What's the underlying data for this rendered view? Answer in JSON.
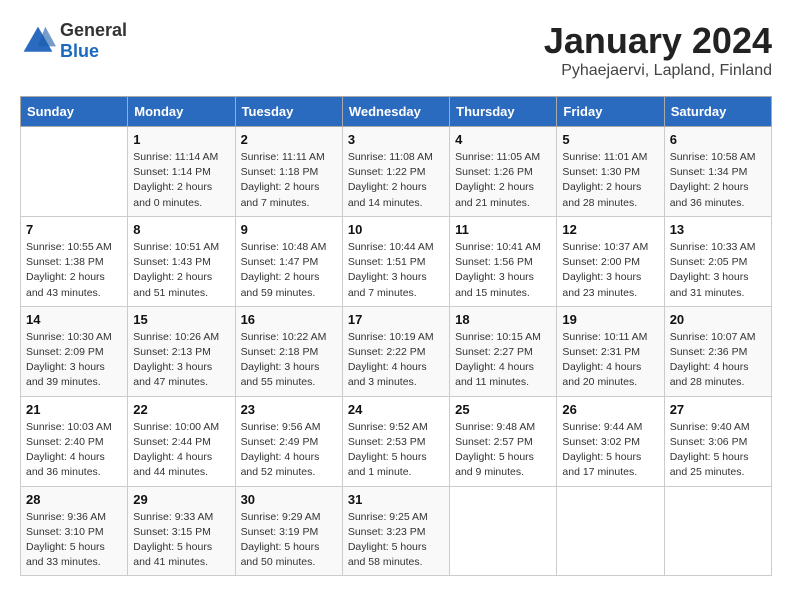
{
  "header": {
    "logo_general": "General",
    "logo_blue": "Blue",
    "title": "January 2024",
    "subtitle": "Pyhaejaervi, Lapland, Finland"
  },
  "days_of_week": [
    "Sunday",
    "Monday",
    "Tuesday",
    "Wednesday",
    "Thursday",
    "Friday",
    "Saturday"
  ],
  "weeks": [
    [
      {
        "day": "",
        "sunrise": "",
        "sunset": "",
        "daylight": ""
      },
      {
        "day": "1",
        "sunrise": "Sunrise: 11:14 AM",
        "sunset": "Sunset: 1:14 PM",
        "daylight": "Daylight: 2 hours and 0 minutes."
      },
      {
        "day": "2",
        "sunrise": "Sunrise: 11:11 AM",
        "sunset": "Sunset: 1:18 PM",
        "daylight": "Daylight: 2 hours and 7 minutes."
      },
      {
        "day": "3",
        "sunrise": "Sunrise: 11:08 AM",
        "sunset": "Sunset: 1:22 PM",
        "daylight": "Daylight: 2 hours and 14 minutes."
      },
      {
        "day": "4",
        "sunrise": "Sunrise: 11:05 AM",
        "sunset": "Sunset: 1:26 PM",
        "daylight": "Daylight: 2 hours and 21 minutes."
      },
      {
        "day": "5",
        "sunrise": "Sunrise: 11:01 AM",
        "sunset": "Sunset: 1:30 PM",
        "daylight": "Daylight: 2 hours and 28 minutes."
      },
      {
        "day": "6",
        "sunrise": "Sunrise: 10:58 AM",
        "sunset": "Sunset: 1:34 PM",
        "daylight": "Daylight: 2 hours and 36 minutes."
      }
    ],
    [
      {
        "day": "7",
        "sunrise": "Sunrise: 10:55 AM",
        "sunset": "Sunset: 1:38 PM",
        "daylight": "Daylight: 2 hours and 43 minutes."
      },
      {
        "day": "8",
        "sunrise": "Sunrise: 10:51 AM",
        "sunset": "Sunset: 1:43 PM",
        "daylight": "Daylight: 2 hours and 51 minutes."
      },
      {
        "day": "9",
        "sunrise": "Sunrise: 10:48 AM",
        "sunset": "Sunset: 1:47 PM",
        "daylight": "Daylight: 2 hours and 59 minutes."
      },
      {
        "day": "10",
        "sunrise": "Sunrise: 10:44 AM",
        "sunset": "Sunset: 1:51 PM",
        "daylight": "Daylight: 3 hours and 7 minutes."
      },
      {
        "day": "11",
        "sunrise": "Sunrise: 10:41 AM",
        "sunset": "Sunset: 1:56 PM",
        "daylight": "Daylight: 3 hours and 15 minutes."
      },
      {
        "day": "12",
        "sunrise": "Sunrise: 10:37 AM",
        "sunset": "Sunset: 2:00 PM",
        "daylight": "Daylight: 3 hours and 23 minutes."
      },
      {
        "day": "13",
        "sunrise": "Sunrise: 10:33 AM",
        "sunset": "Sunset: 2:05 PM",
        "daylight": "Daylight: 3 hours and 31 minutes."
      }
    ],
    [
      {
        "day": "14",
        "sunrise": "Sunrise: 10:30 AM",
        "sunset": "Sunset: 2:09 PM",
        "daylight": "Daylight: 3 hours and 39 minutes."
      },
      {
        "day": "15",
        "sunrise": "Sunrise: 10:26 AM",
        "sunset": "Sunset: 2:13 PM",
        "daylight": "Daylight: 3 hours and 47 minutes."
      },
      {
        "day": "16",
        "sunrise": "Sunrise: 10:22 AM",
        "sunset": "Sunset: 2:18 PM",
        "daylight": "Daylight: 3 hours and 55 minutes."
      },
      {
        "day": "17",
        "sunrise": "Sunrise: 10:19 AM",
        "sunset": "Sunset: 2:22 PM",
        "daylight": "Daylight: 4 hours and 3 minutes."
      },
      {
        "day": "18",
        "sunrise": "Sunrise: 10:15 AM",
        "sunset": "Sunset: 2:27 PM",
        "daylight": "Daylight: 4 hours and 11 minutes."
      },
      {
        "day": "19",
        "sunrise": "Sunrise: 10:11 AM",
        "sunset": "Sunset: 2:31 PM",
        "daylight": "Daylight: 4 hours and 20 minutes."
      },
      {
        "day": "20",
        "sunrise": "Sunrise: 10:07 AM",
        "sunset": "Sunset: 2:36 PM",
        "daylight": "Daylight: 4 hours and 28 minutes."
      }
    ],
    [
      {
        "day": "21",
        "sunrise": "Sunrise: 10:03 AM",
        "sunset": "Sunset: 2:40 PM",
        "daylight": "Daylight: 4 hours and 36 minutes."
      },
      {
        "day": "22",
        "sunrise": "Sunrise: 10:00 AM",
        "sunset": "Sunset: 2:44 PM",
        "daylight": "Daylight: 4 hours and 44 minutes."
      },
      {
        "day": "23",
        "sunrise": "Sunrise: 9:56 AM",
        "sunset": "Sunset: 2:49 PM",
        "daylight": "Daylight: 4 hours and 52 minutes."
      },
      {
        "day": "24",
        "sunrise": "Sunrise: 9:52 AM",
        "sunset": "Sunset: 2:53 PM",
        "daylight": "Daylight: 5 hours and 1 minute."
      },
      {
        "day": "25",
        "sunrise": "Sunrise: 9:48 AM",
        "sunset": "Sunset: 2:57 PM",
        "daylight": "Daylight: 5 hours and 9 minutes."
      },
      {
        "day": "26",
        "sunrise": "Sunrise: 9:44 AM",
        "sunset": "Sunset: 3:02 PM",
        "daylight": "Daylight: 5 hours and 17 minutes."
      },
      {
        "day": "27",
        "sunrise": "Sunrise: 9:40 AM",
        "sunset": "Sunset: 3:06 PM",
        "daylight": "Daylight: 5 hours and 25 minutes."
      }
    ],
    [
      {
        "day": "28",
        "sunrise": "Sunrise: 9:36 AM",
        "sunset": "Sunset: 3:10 PM",
        "daylight": "Daylight: 5 hours and 33 minutes."
      },
      {
        "day": "29",
        "sunrise": "Sunrise: 9:33 AM",
        "sunset": "Sunset: 3:15 PM",
        "daylight": "Daylight: 5 hours and 41 minutes."
      },
      {
        "day": "30",
        "sunrise": "Sunrise: 9:29 AM",
        "sunset": "Sunset: 3:19 PM",
        "daylight": "Daylight: 5 hours and 50 minutes."
      },
      {
        "day": "31",
        "sunrise": "Sunrise: 9:25 AM",
        "sunset": "Sunset: 3:23 PM",
        "daylight": "Daylight: 5 hours and 58 minutes."
      },
      {
        "day": "",
        "sunrise": "",
        "sunset": "",
        "daylight": ""
      },
      {
        "day": "",
        "sunrise": "",
        "sunset": "",
        "daylight": ""
      },
      {
        "day": "",
        "sunrise": "",
        "sunset": "",
        "daylight": ""
      }
    ]
  ]
}
